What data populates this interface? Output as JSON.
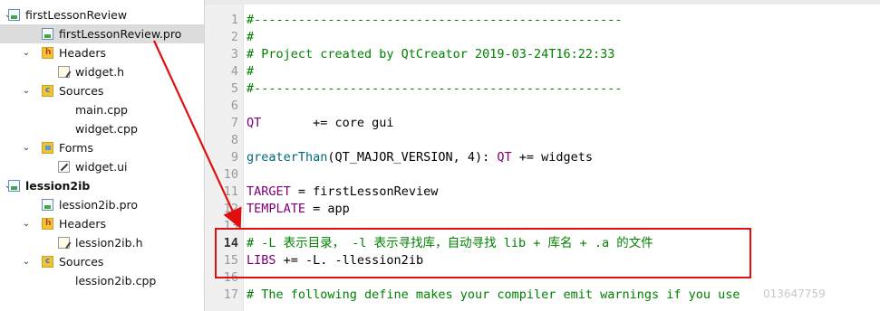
{
  "tree": [
    {
      "label": "firstLessonReview",
      "icon": "pro-icon",
      "expand": "collapse-arrow-icon",
      "level": 0,
      "bold": false,
      "selected": false
    },
    {
      "label": "firstLessonReview.pro",
      "icon": "pro-file-icon",
      "expand": "",
      "level": 1,
      "bold": false,
      "selected": true
    },
    {
      "label": "Headers",
      "icon": "headers-folder-icon",
      "expand": "collapse-arrow-icon",
      "level": 1,
      "bold": false,
      "selected": false
    },
    {
      "label": "widget.h",
      "icon": "header-file-icon",
      "expand": "",
      "level": 2,
      "bold": false,
      "selected": false
    },
    {
      "label": "Sources",
      "icon": "sources-folder-icon",
      "expand": "collapse-arrow-icon",
      "level": 1,
      "bold": false,
      "selected": false
    },
    {
      "label": "main.cpp",
      "icon": "",
      "expand": "",
      "level": 2,
      "bold": false,
      "selected": false
    },
    {
      "label": "widget.cpp",
      "icon": "",
      "expand": "",
      "level": 2,
      "bold": false,
      "selected": false
    },
    {
      "label": "Forms",
      "icon": "forms-folder-icon",
      "expand": "collapse-arrow-icon",
      "level": 1,
      "bold": false,
      "selected": false
    },
    {
      "label": "widget.ui",
      "icon": "ui-file-icon",
      "expand": "",
      "level": 2,
      "bold": false,
      "selected": false
    },
    {
      "label": "lession2ib",
      "icon": "pro-icon",
      "expand": "collapse-arrow-icon",
      "level": 0,
      "bold": true,
      "selected": false
    },
    {
      "label": "lession2ib.pro",
      "icon": "pro-file-icon",
      "expand": "",
      "level": 1,
      "bold": false,
      "selected": false
    },
    {
      "label": "Headers",
      "icon": "headers-folder-icon",
      "expand": "collapse-arrow-icon",
      "level": 1,
      "bold": false,
      "selected": false
    },
    {
      "label": "lession2ib.h",
      "icon": "header-file-icon",
      "expand": "",
      "level": 2,
      "bold": false,
      "selected": false
    },
    {
      "label": "Sources",
      "icon": "sources-folder-icon",
      "expand": "collapse-arrow-icon",
      "level": 1,
      "bold": false,
      "selected": false
    },
    {
      "label": "lession2ib.cpp",
      "icon": "",
      "expand": "",
      "level": 2,
      "bold": false,
      "selected": false
    }
  ],
  "editor": {
    "current_line": "14",
    "lines": [
      {
        "num": "1",
        "segments": [
          {
            "t": "#--------------------------------------------------",
            "c": "cm"
          }
        ]
      },
      {
        "num": "2",
        "segments": [
          {
            "t": "#",
            "c": "cm"
          }
        ]
      },
      {
        "num": "3",
        "segments": [
          {
            "t": "# Project created by QtCreator 2019-03-24T16:22:33",
            "c": "cm"
          }
        ]
      },
      {
        "num": "4",
        "segments": [
          {
            "t": "#",
            "c": "cm"
          }
        ]
      },
      {
        "num": "5",
        "segments": [
          {
            "t": "#--------------------------------------------------",
            "c": "cm"
          }
        ]
      },
      {
        "num": "6",
        "segments": []
      },
      {
        "num": "7",
        "segments": [
          {
            "t": "QT",
            "c": "kw"
          },
          {
            "t": "       += core gui",
            "c": "tx"
          }
        ]
      },
      {
        "num": "8",
        "segments": []
      },
      {
        "num": "9",
        "segments": [
          {
            "t": "greaterThan",
            "c": "fn"
          },
          {
            "t": "(QT_MAJOR_VERSION, 4): ",
            "c": "tx"
          },
          {
            "t": "QT",
            "c": "kw"
          },
          {
            "t": " += widgets",
            "c": "tx"
          }
        ]
      },
      {
        "num": "10",
        "segments": []
      },
      {
        "num": "11",
        "segments": [
          {
            "t": "TARGET",
            "c": "kw"
          },
          {
            "t": " = firstLessonReview",
            "c": "tx"
          }
        ]
      },
      {
        "num": "12",
        "segments": [
          {
            "t": "TEMPLATE",
            "c": "kw"
          },
          {
            "t": " = app",
            "c": "tx"
          }
        ]
      },
      {
        "num": "13",
        "segments": []
      },
      {
        "num": "14",
        "segments": [
          {
            "t": "# -L 表示目录， -l 表示寻找库，自动寻找 lib + 库名 + .a 的文件",
            "c": "cm"
          }
        ]
      },
      {
        "num": "15",
        "segments": [
          {
            "t": "LIBS",
            "c": "kw"
          },
          {
            "t": " += -L. -llession2ib",
            "c": "tx"
          }
        ]
      },
      {
        "num": "16",
        "segments": []
      },
      {
        "num": "17",
        "segments": [
          {
            "t": "# The following define makes your compiler emit warnings if you use",
            "c": "cm"
          }
        ]
      }
    ]
  },
  "annotation_color": "#e01010",
  "watermark": "013647759"
}
